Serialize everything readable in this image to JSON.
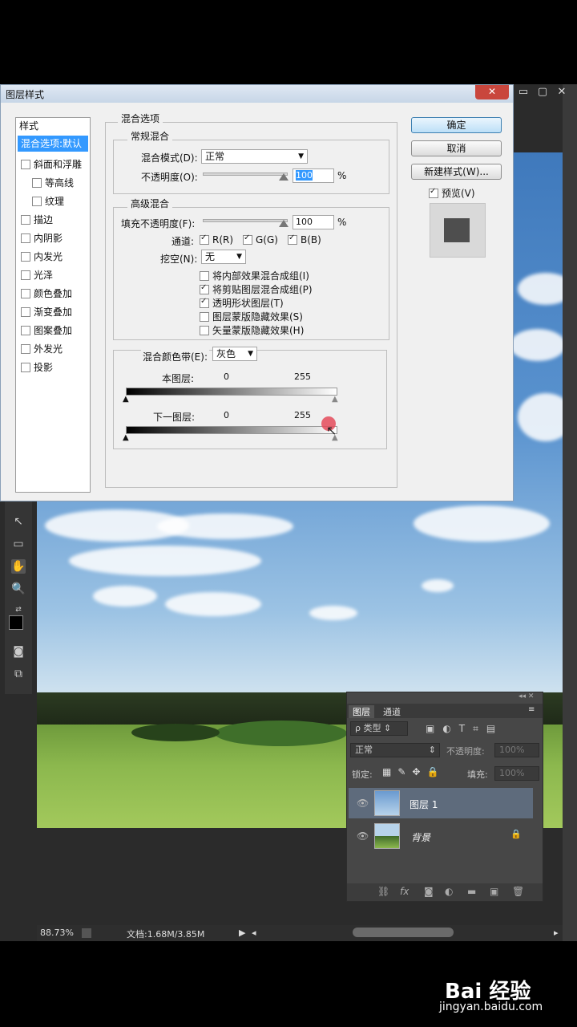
{
  "dialog": {
    "title": "图层样式",
    "style_list_header": "样式",
    "styles": [
      {
        "label": "混合选项:默认",
        "selected": true,
        "checkbox": false
      },
      {
        "label": "斜面和浮雕",
        "checkbox": true
      },
      {
        "label": "等高线",
        "checkbox": true,
        "indent": true
      },
      {
        "label": "纹理",
        "checkbox": true,
        "indent": true
      },
      {
        "label": "描边",
        "checkbox": true
      },
      {
        "label": "内阴影",
        "checkbox": true
      },
      {
        "label": "内发光",
        "checkbox": true
      },
      {
        "label": "光泽",
        "checkbox": true
      },
      {
        "label": "颜色叠加",
        "checkbox": true
      },
      {
        "label": "渐变叠加",
        "checkbox": true
      },
      {
        "label": "图案叠加",
        "checkbox": true
      },
      {
        "label": "外发光",
        "checkbox": true
      },
      {
        "label": "投影",
        "checkbox": true
      }
    ],
    "blend_options_title": "混合选项",
    "general_blend": {
      "title": "常规混合",
      "mode_label": "混合模式(D):",
      "mode_value": "正常",
      "opacity_label": "不透明度(O):",
      "opacity_value": "100",
      "unit": "%"
    },
    "advanced_blend": {
      "title": "高级混合",
      "fill_label": "填充不透明度(F):",
      "fill_value": "100",
      "unit": "%",
      "channels_label": "通道:",
      "channels": [
        {
          "label": "R(R)",
          "checked": true
        },
        {
          "label": "G(G)",
          "checked": true
        },
        {
          "label": "B(B)",
          "checked": true
        }
      ],
      "knockout_label": "挖空(N):",
      "knockout_value": "无",
      "options": [
        {
          "label": "将内部效果混合成组(I)",
          "checked": false
        },
        {
          "label": "将剪贴图层混合成组(P)",
          "checked": true
        },
        {
          "label": "透明形状图层(T)",
          "checked": true
        },
        {
          "label": "图层蒙版隐藏效果(S)",
          "checked": false
        },
        {
          "label": "矢量蒙版隐藏效果(H)",
          "checked": false
        }
      ]
    },
    "blend_if": {
      "label": "混合颜色带(E):",
      "value": "灰色",
      "this_layer_label": "本图层:",
      "this_min": "0",
      "this_max": "255",
      "under_layer_label": "下一图层:",
      "under_min": "0",
      "under_max": "255"
    },
    "buttons": {
      "ok": "确定",
      "cancel": "取消",
      "new_style": "新建样式(W)...",
      "preview_label": "预览(V)",
      "preview_checked": true
    }
  },
  "status_bar": {
    "zoom": "88.73%",
    "doc_info": "文档:1.68M/3.85M"
  },
  "layers_panel": {
    "tabs": [
      "图层",
      "通道"
    ],
    "filter_label": "ρ 类型",
    "blend_mode": "正常",
    "opacity_label": "不透明度:",
    "opacity_value": "100%",
    "lock_label": "锁定:",
    "fill_label": "填充:",
    "fill_value": "100%",
    "layers": [
      {
        "name": "图层 1",
        "selected": true
      },
      {
        "name": "背景",
        "locked": true
      }
    ]
  },
  "watermark": {
    "logo": "Bai 经验",
    "url": "jingyan.baidu.com"
  },
  "colors": {
    "dialog_bg": "#f0f0f0",
    "selection_blue": "#3399ff",
    "ps_dark": "#2b2b2b",
    "panel_gray": "#474747"
  }
}
